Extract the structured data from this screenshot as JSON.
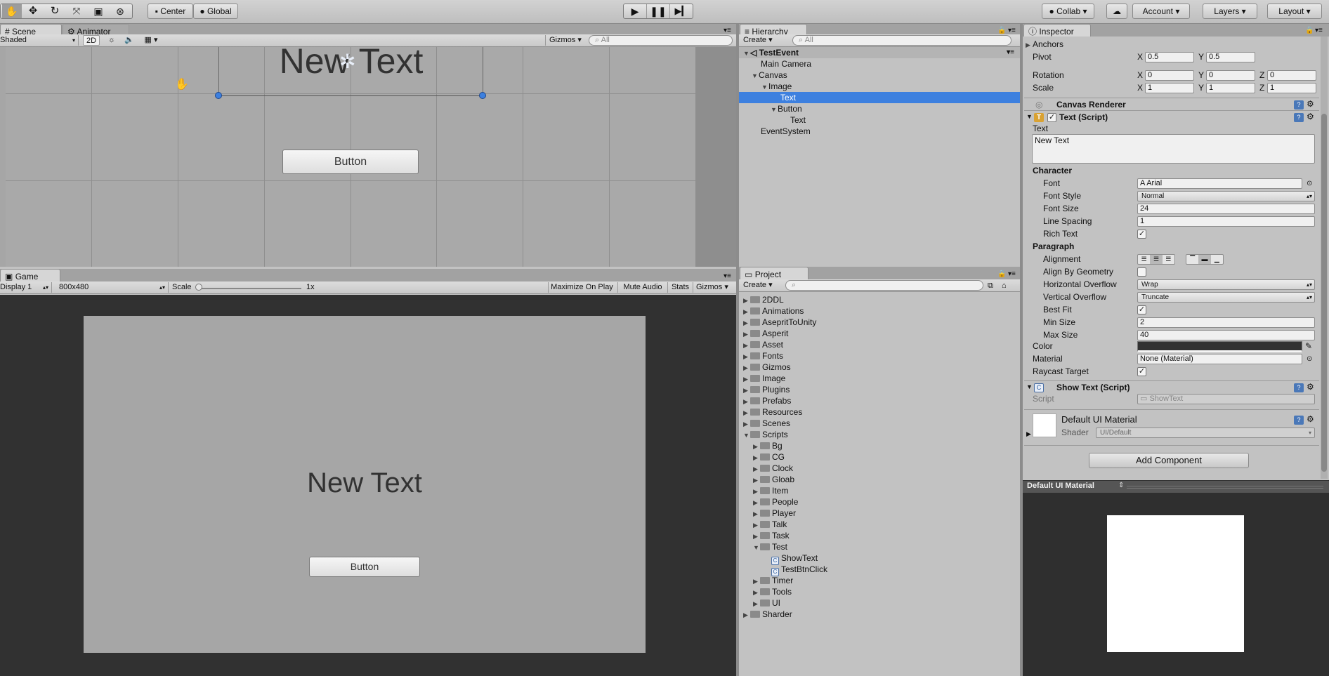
{
  "toolbar": {
    "pivot_mode": "Center",
    "pivot_rotation": "Global",
    "collab": "Collab",
    "account": "Account",
    "layers": "Layers",
    "layout": "Layout"
  },
  "scene": {
    "tab_scene": "Scene",
    "tab_animator": "Animator",
    "shading": "Shaded",
    "mode_2d": "2D",
    "gizmos": "Gizmos",
    "search_placeholder": "All",
    "text_object": "New Text",
    "button_label": "Button"
  },
  "game": {
    "tab": "Game",
    "display": "Display 1",
    "resolution": "800x480",
    "scale_label": "Scale",
    "scale_value": "1x",
    "maximize": "Maximize On Play",
    "mute": "Mute Audio",
    "stats": "Stats",
    "gizmos": "Gizmos",
    "text_object": "New Text",
    "button_label": "Button"
  },
  "hierarchy": {
    "tab": "Hierarchy",
    "create": "Create",
    "search_placeholder": "All",
    "scene_name": "TestEvent",
    "items": [
      {
        "label": "Main Camera"
      },
      {
        "label": "Canvas"
      },
      {
        "label": "Image"
      },
      {
        "label": "Text"
      },
      {
        "label": "Button"
      },
      {
        "label": "Text"
      },
      {
        "label": "EventSystem"
      }
    ]
  },
  "project": {
    "tab": "Project",
    "create": "Create",
    "folders": [
      {
        "label": "2DDL"
      },
      {
        "label": "Animations"
      },
      {
        "label": "AsepritToUnity"
      },
      {
        "label": "Asperit"
      },
      {
        "label": "Asset"
      },
      {
        "label": "Fonts"
      },
      {
        "label": "Gizmos"
      },
      {
        "label": "Image"
      },
      {
        "label": "Plugins"
      },
      {
        "label": "Prefabs"
      },
      {
        "label": "Resources"
      },
      {
        "label": "Scenes"
      },
      {
        "label": "Scripts"
      },
      {
        "label": "Bg"
      },
      {
        "label": "CG"
      },
      {
        "label": "Clock"
      },
      {
        "label": "Gloab"
      },
      {
        "label": "Item"
      },
      {
        "label": "People"
      },
      {
        "label": "Player"
      },
      {
        "label": "Talk"
      },
      {
        "label": "Task"
      },
      {
        "label": "Test"
      },
      {
        "label": "ShowText"
      },
      {
        "label": "TestBtnClick"
      },
      {
        "label": "Timer"
      },
      {
        "label": "Tools"
      },
      {
        "label": "UI"
      },
      {
        "label": "Sharder"
      }
    ]
  },
  "inspector": {
    "tab": "Inspector",
    "anchors": "Anchors",
    "pivot": {
      "label": "Pivot",
      "x": "0.5",
      "y": "0.5"
    },
    "rotation": {
      "label": "Rotation",
      "x": "0",
      "y": "0",
      "z": "0"
    },
    "scale": {
      "label": "Scale",
      "x": "1",
      "y": "1",
      "z": "1"
    },
    "axis_x": "X",
    "axis_y": "Y",
    "axis_z": "Z",
    "canvas_renderer": "Canvas Renderer",
    "text_script": "Text (Script)",
    "text_label": "Text",
    "text_value": "New Text",
    "character": "Character",
    "font_label": "Font",
    "font_value": "Arial",
    "font_style_label": "Font Style",
    "font_style_value": "Normal",
    "font_size_label": "Font Size",
    "font_size_value": "24",
    "line_spacing_label": "Line Spacing",
    "line_spacing_value": "1",
    "rich_text_label": "Rich Text",
    "paragraph": "Paragraph",
    "alignment_label": "Alignment",
    "align_geometry_label": "Align By Geometry",
    "h_overflow_label": "Horizontal Overflow",
    "h_overflow_value": "Wrap",
    "v_overflow_label": "Vertical Overflow",
    "v_overflow_value": "Truncate",
    "best_fit_label": "Best Fit",
    "min_size_label": "Min Size",
    "min_size_value": "2",
    "max_size_label": "Max Size",
    "max_size_value": "40",
    "color_label": "Color",
    "material_label": "Material",
    "material_value": "None (Material)",
    "raycast_label": "Raycast Target",
    "show_text_script": "Show Text (Script)",
    "script_label": "Script",
    "script_value": "ShowText",
    "default_material": "Default UI Material",
    "shader_label": "Shader",
    "shader_value": "UI/Default",
    "add_component": "Add Component",
    "preview_title": "Default UI Material"
  },
  "colors": {
    "selection": "#3d80df",
    "text_color_swatch": "#323232"
  }
}
